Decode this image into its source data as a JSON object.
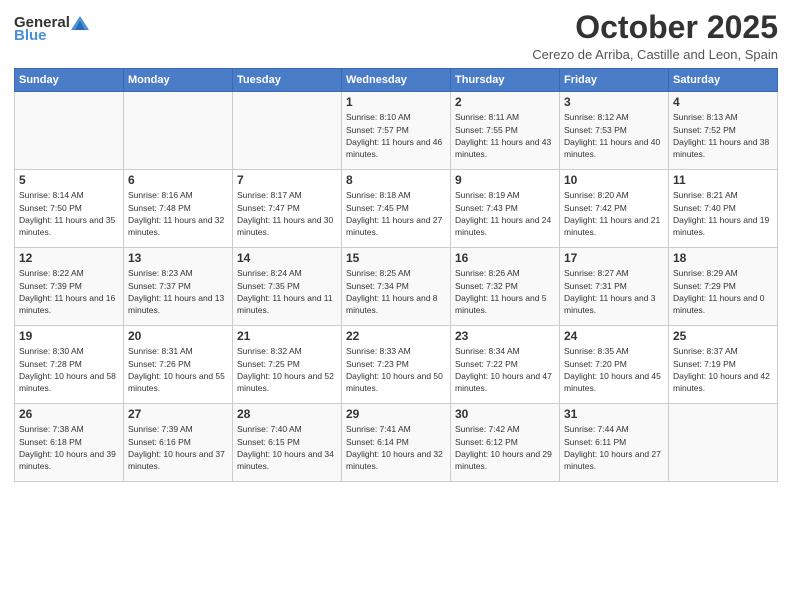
{
  "header": {
    "logo_general": "General",
    "logo_blue": "Blue",
    "month_title": "October 2025",
    "subtitle": "Cerezo de Arriba, Castille and Leon, Spain"
  },
  "days_of_week": [
    "Sunday",
    "Monday",
    "Tuesday",
    "Wednesday",
    "Thursday",
    "Friday",
    "Saturday"
  ],
  "weeks": [
    [
      {
        "day": "",
        "content": ""
      },
      {
        "day": "",
        "content": ""
      },
      {
        "day": "",
        "content": ""
      },
      {
        "day": "1",
        "content": "Sunrise: 8:10 AM\nSunset: 7:57 PM\nDaylight: 11 hours and 46 minutes."
      },
      {
        "day": "2",
        "content": "Sunrise: 8:11 AM\nSunset: 7:55 PM\nDaylight: 11 hours and 43 minutes."
      },
      {
        "day": "3",
        "content": "Sunrise: 8:12 AM\nSunset: 7:53 PM\nDaylight: 11 hours and 40 minutes."
      },
      {
        "day": "4",
        "content": "Sunrise: 8:13 AM\nSunset: 7:52 PM\nDaylight: 11 hours and 38 minutes."
      }
    ],
    [
      {
        "day": "5",
        "content": "Sunrise: 8:14 AM\nSunset: 7:50 PM\nDaylight: 11 hours and 35 minutes."
      },
      {
        "day": "6",
        "content": "Sunrise: 8:16 AM\nSunset: 7:48 PM\nDaylight: 11 hours and 32 minutes."
      },
      {
        "day": "7",
        "content": "Sunrise: 8:17 AM\nSunset: 7:47 PM\nDaylight: 11 hours and 30 minutes."
      },
      {
        "day": "8",
        "content": "Sunrise: 8:18 AM\nSunset: 7:45 PM\nDaylight: 11 hours and 27 minutes."
      },
      {
        "day": "9",
        "content": "Sunrise: 8:19 AM\nSunset: 7:43 PM\nDaylight: 11 hours and 24 minutes."
      },
      {
        "day": "10",
        "content": "Sunrise: 8:20 AM\nSunset: 7:42 PM\nDaylight: 11 hours and 21 minutes."
      },
      {
        "day": "11",
        "content": "Sunrise: 8:21 AM\nSunset: 7:40 PM\nDaylight: 11 hours and 19 minutes."
      }
    ],
    [
      {
        "day": "12",
        "content": "Sunrise: 8:22 AM\nSunset: 7:39 PM\nDaylight: 11 hours and 16 minutes."
      },
      {
        "day": "13",
        "content": "Sunrise: 8:23 AM\nSunset: 7:37 PM\nDaylight: 11 hours and 13 minutes."
      },
      {
        "day": "14",
        "content": "Sunrise: 8:24 AM\nSunset: 7:35 PM\nDaylight: 11 hours and 11 minutes."
      },
      {
        "day": "15",
        "content": "Sunrise: 8:25 AM\nSunset: 7:34 PM\nDaylight: 11 hours and 8 minutes."
      },
      {
        "day": "16",
        "content": "Sunrise: 8:26 AM\nSunset: 7:32 PM\nDaylight: 11 hours and 5 minutes."
      },
      {
        "day": "17",
        "content": "Sunrise: 8:27 AM\nSunset: 7:31 PM\nDaylight: 11 hours and 3 minutes."
      },
      {
        "day": "18",
        "content": "Sunrise: 8:29 AM\nSunset: 7:29 PM\nDaylight: 11 hours and 0 minutes."
      }
    ],
    [
      {
        "day": "19",
        "content": "Sunrise: 8:30 AM\nSunset: 7:28 PM\nDaylight: 10 hours and 58 minutes."
      },
      {
        "day": "20",
        "content": "Sunrise: 8:31 AM\nSunset: 7:26 PM\nDaylight: 10 hours and 55 minutes."
      },
      {
        "day": "21",
        "content": "Sunrise: 8:32 AM\nSunset: 7:25 PM\nDaylight: 10 hours and 52 minutes."
      },
      {
        "day": "22",
        "content": "Sunrise: 8:33 AM\nSunset: 7:23 PM\nDaylight: 10 hours and 50 minutes."
      },
      {
        "day": "23",
        "content": "Sunrise: 8:34 AM\nSunset: 7:22 PM\nDaylight: 10 hours and 47 minutes."
      },
      {
        "day": "24",
        "content": "Sunrise: 8:35 AM\nSunset: 7:20 PM\nDaylight: 10 hours and 45 minutes."
      },
      {
        "day": "25",
        "content": "Sunrise: 8:37 AM\nSunset: 7:19 PM\nDaylight: 10 hours and 42 minutes."
      }
    ],
    [
      {
        "day": "26",
        "content": "Sunrise: 7:38 AM\nSunset: 6:18 PM\nDaylight: 10 hours and 39 minutes."
      },
      {
        "day": "27",
        "content": "Sunrise: 7:39 AM\nSunset: 6:16 PM\nDaylight: 10 hours and 37 minutes."
      },
      {
        "day": "28",
        "content": "Sunrise: 7:40 AM\nSunset: 6:15 PM\nDaylight: 10 hours and 34 minutes."
      },
      {
        "day": "29",
        "content": "Sunrise: 7:41 AM\nSunset: 6:14 PM\nDaylight: 10 hours and 32 minutes."
      },
      {
        "day": "30",
        "content": "Sunrise: 7:42 AM\nSunset: 6:12 PM\nDaylight: 10 hours and 29 minutes."
      },
      {
        "day": "31",
        "content": "Sunrise: 7:44 AM\nSunset: 6:11 PM\nDaylight: 10 hours and 27 minutes."
      },
      {
        "day": "",
        "content": ""
      }
    ]
  ]
}
